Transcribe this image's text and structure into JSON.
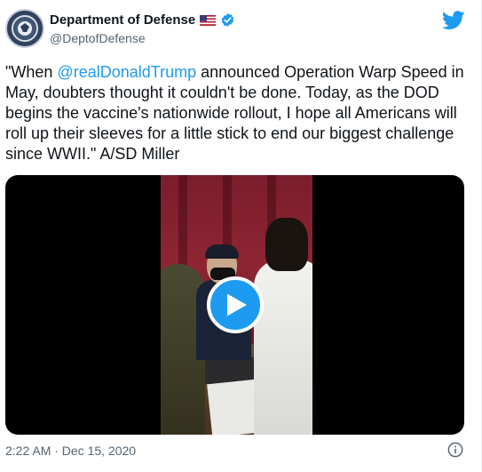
{
  "account": {
    "display_name": "Department of Defense",
    "handle": "@DeptofDefense",
    "flag_icon": "us-flag-icon",
    "verified_icon": "verified-badge-icon"
  },
  "tweet": {
    "text_before": "\"When ",
    "mention": "@realDonaldTrump",
    "text_after": " announced Operation Warp Speed in May, doubters thought it couldn't be done. Today, as the DOD begins the vaccine's nationwide rollout, I hope all Americans will roll up their sleeves for a little stick to end our biggest challenge since WWII.\" A/SD Miller"
  },
  "media": {
    "type": "video",
    "play_icon": "play-icon"
  },
  "footer": {
    "timestamp": "2:22 AM · Dec 15, 2020",
    "info_icon": "info-icon"
  },
  "colors": {
    "accent": "#1d9bf0",
    "text": "#0f1419",
    "secondary": "#536471"
  }
}
